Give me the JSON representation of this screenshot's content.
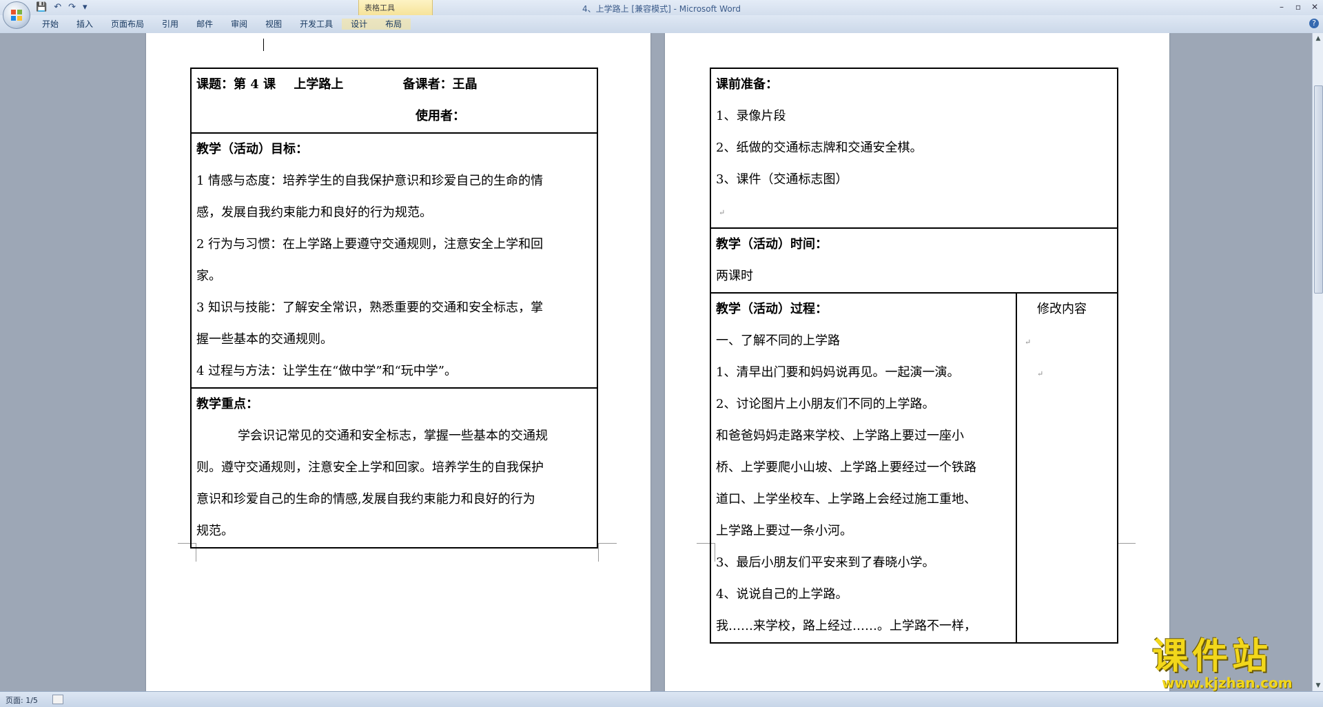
{
  "window": {
    "title": "4、上学路上 [兼容模式] - Microsoft Word",
    "controls": [
      "–",
      "▫",
      "✕"
    ],
    "contextual_group": "表格工具"
  },
  "qat": {
    "icons": [
      "save-icon",
      "undo-icon",
      "redo-icon",
      "customize-icon"
    ],
    "glyphs": [
      "💾",
      "↶",
      "↷",
      "▾"
    ]
  },
  "ribbon": {
    "tabs": [
      "开始",
      "插入",
      "页面布局",
      "引用",
      "邮件",
      "审阅",
      "视图",
      "开发工具",
      "设计",
      "布局"
    ],
    "help": "?"
  },
  "left_table": {
    "header": {
      "title_label": "课题：第 4 课",
      "title_value": "上学路上",
      "preparer": "备课者：王晶",
      "user": "使用者："
    },
    "goals_heading": "教学（活动）目标：",
    "goals_lines": [
      "1 情感与态度：培养学生的自我保护意识和珍爱自己的生命的情",
      "感，发展自我约束能力和良好的行为规范。",
      "2 行为与习惯：在上学路上要遵守交通规则，注意安全上学和回",
      "家。",
      "3 知识与技能：了解安全常识，熟悉重要的交通和安全标志，掌",
      "握一些基本的交通规则。",
      "4 过程与方法：让学生在“做中学”和“玩中学”。"
    ],
    "key_heading": "教学重点：",
    "key_lines": [
      "学会识记常见的交通和安全标志，掌握一些基本的交通规",
      "则。遵守交通规则，注意安全上学和回家。培养学生的自我保护",
      "意识和珍爱自己的生命的情感,发展自我约束能力和良好的行为",
      "规范。"
    ]
  },
  "right_table": {
    "prep_heading": "课前准备：",
    "prep_lines": [
      "1、录像片段",
      "2、纸做的交通标志牌和交通安全棋。",
      "3、课件（交通标志图）"
    ],
    "time_heading": "教学（活动）时间：",
    "time_value": "两课时",
    "process_heading": "教学（活动）过程：",
    "process_lines": [
      "一、了解不同的上学路",
      "1、清早出门要和妈妈说再见。一起演一演。",
      "2、讨论图片上小朋友们不同的上学路。",
      "和爸爸妈妈走路来学校、上学路上要过一座小",
      "桥、上学要爬小山坡、上学路上要经过一个铁路",
      "道口、上学坐校车、上学路上会经过施工重地、",
      "上学路上要过一条小河。",
      "3、最后小朋友们平安来到了春晓小学。",
      "4、说说自己的上学路。",
      "我……来学校，路上经过……。上学路不一样，"
    ],
    "revise_heading": "修改内容"
  },
  "paragraph_mark": "↵",
  "status": {
    "page": "页面: 1/5"
  },
  "watermark": {
    "text": "课件站",
    "url": "www.kjzhan.com"
  }
}
